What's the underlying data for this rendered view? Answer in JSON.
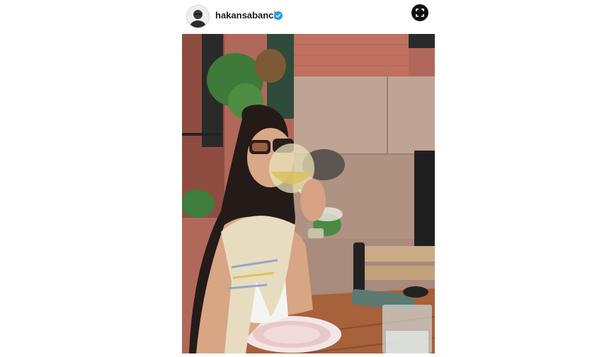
{
  "post": {
    "username": "hakansabanci",
    "verified": true,
    "avatar_icon": "profile-avatar",
    "expand_icon": "expand-icon"
  },
  "photo": {
    "alt_subject": "photo"
  },
  "colors": {
    "verified_blue": "#1d9bf0",
    "expand_bg": "#111111"
  }
}
